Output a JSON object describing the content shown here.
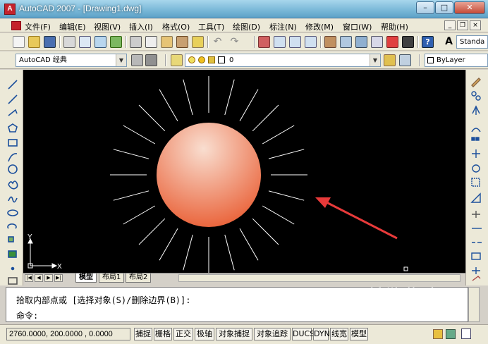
{
  "window": {
    "title": "AutoCAD 2007 - [Drawing1.dwg]",
    "app_icon": "autocad-logo-icon",
    "controls": [
      "minimize-icon",
      "maximize-icon",
      "close-icon"
    ]
  },
  "menubar": {
    "items": [
      "文件(F)",
      "编辑(E)",
      "视图(V)",
      "插入(I)",
      "格式(O)",
      "工具(T)",
      "绘图(D)",
      "标注(N)",
      "修改(M)",
      "窗口(W)",
      "帮助(H)"
    ],
    "mdi_controls": [
      "_",
      "❐",
      "×"
    ]
  },
  "toolbar": {
    "style_combo": "Standa",
    "workspace_combo": "AutoCAD 经典",
    "layer_combo": "0",
    "linetype_combo": "ByLayer"
  },
  "canvas": {
    "background": "#000000",
    "sun_gradient": [
      "#f8ddd0",
      "#e85a2a"
    ],
    "arrow_color": "#e83a3a",
    "ucs_x": "X",
    "ucs_y": "Y",
    "ray_count": 24
  },
  "tabs": {
    "items": [
      "模型",
      "布局1",
      "布局2"
    ],
    "active": "模型"
  },
  "command": {
    "line1": "拾取内部点或 [选择对象(S)/删除边界(B)]:",
    "line2": "命令:"
  },
  "statusbar": {
    "coords": "2760.0000, 200.0000 , 0.0000",
    "buttons": [
      "捕捉",
      "栅格",
      "正交",
      "极轴",
      "对象捕捉",
      "对象追踪",
      "DUCS",
      "DYN",
      "线宽",
      "模型"
    ]
  },
  "watermark": {
    "brand": "搜狗指南",
    "url": "zhinan.sogou.com"
  }
}
